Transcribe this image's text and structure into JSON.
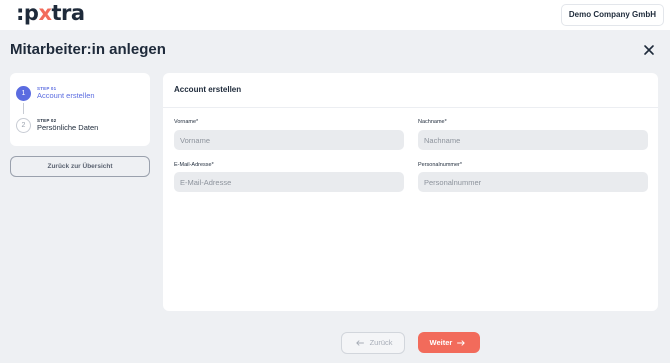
{
  "header": {
    "logo_prefix": ":p",
    "logo_x": "x",
    "logo_suffix": "tra",
    "company": "Demo Company GmbH"
  },
  "page": {
    "title": "Mitarbeiter:in anlegen"
  },
  "steps": [
    {
      "number": "1",
      "step_label": "STEP 01",
      "name": "Account erstellen",
      "state": "active"
    },
    {
      "number": "2",
      "step_label": "STEP 02",
      "name": "Persönliche Daten",
      "state": "inactive"
    }
  ],
  "back_to_overview": "Zurück zur Übersicht",
  "form": {
    "title": "Account erstellen",
    "fields": [
      {
        "label": "Vorname*",
        "placeholder": "Vorname",
        "value": ""
      },
      {
        "label": "Nachname*",
        "placeholder": "Nachname",
        "value": ""
      },
      {
        "label": "E-Mail-Adresse*",
        "placeholder": "E-Mail-Adresse",
        "value": ""
      },
      {
        "label": "Personalnummer*",
        "placeholder": "Personalnummer",
        "value": ""
      }
    ]
  },
  "footer": {
    "back_label": "Zurück",
    "next_label": "Weiter"
  },
  "colors": {
    "accent": "#f26b5b",
    "step_active": "#5b6ce0"
  },
  "icons": {
    "close": "close-icon",
    "back_arrow": "arrow-left-icon",
    "next_arrow": "arrow-right-icon"
  }
}
